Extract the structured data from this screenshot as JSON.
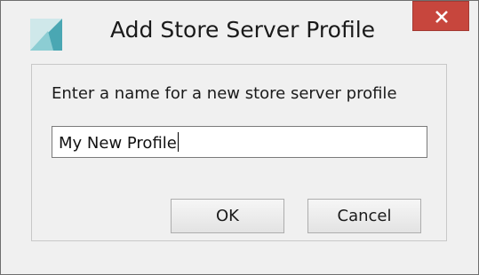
{
  "window": {
    "title": "Add Store Server Profile",
    "app_icon": "store-server-logo-icon",
    "close_icon": "close-icon",
    "close_color": "#c7463d"
  },
  "form": {
    "prompt": "Enter a name for a new store server profile",
    "name_value": "My New Profile"
  },
  "buttons": {
    "ok_label": "OK",
    "cancel_label": "Cancel"
  }
}
